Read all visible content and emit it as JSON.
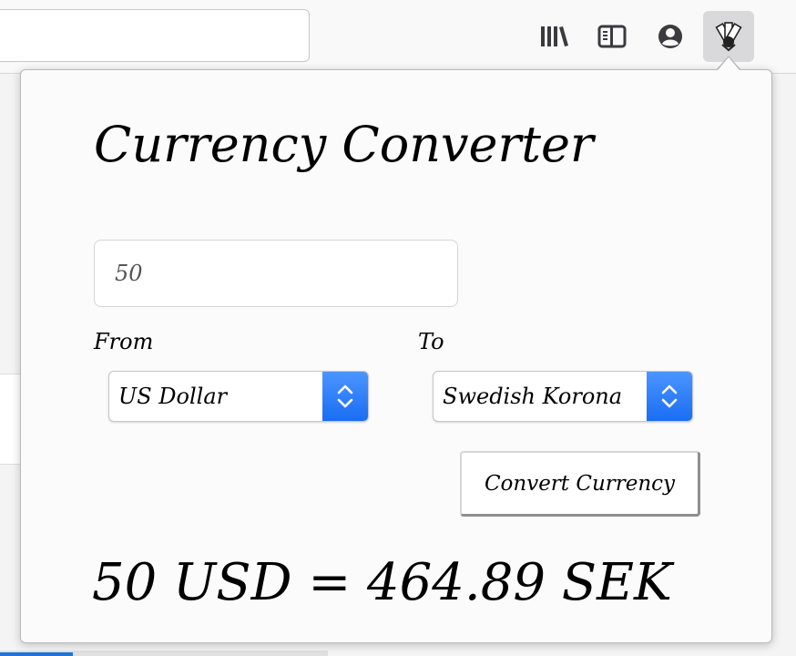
{
  "toolbar": {
    "icons": [
      "library-icon",
      "sidebar-icon",
      "account-icon",
      "currency-extension-icon"
    ]
  },
  "popup": {
    "title": "Currency Converter",
    "amount_value": "50",
    "from_label": "From",
    "to_label": "To",
    "from_selected": "US Dollar",
    "to_selected": "Swedish Korona",
    "convert_label": "Convert Currency",
    "result": "50 USD = 464.89 SEK"
  },
  "colors": {
    "select_accent": "#1a6df3",
    "popup_bg": "#fbfbfb",
    "toolbar_bg": "#f9f9fa"
  }
}
